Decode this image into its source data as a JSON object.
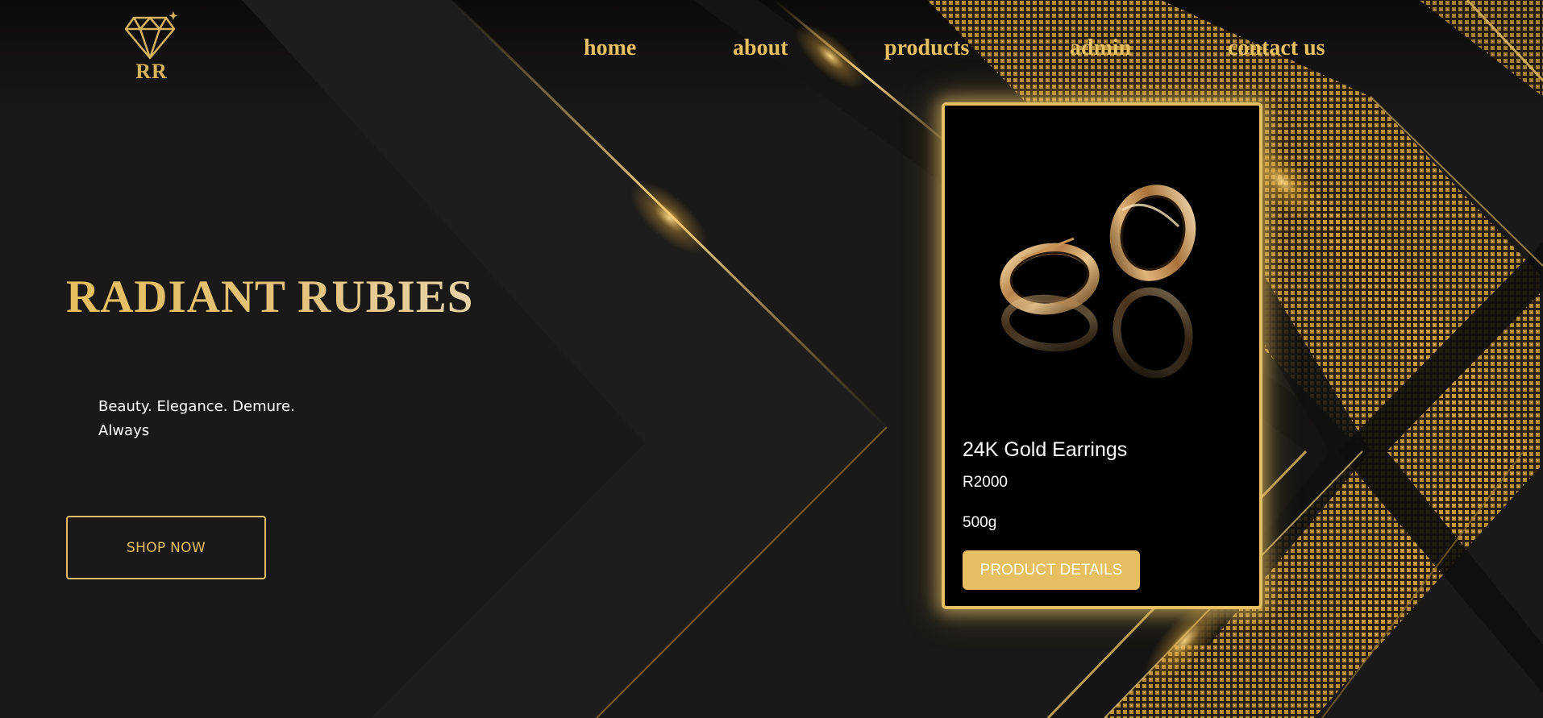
{
  "brand": {
    "logo_text": "RR"
  },
  "nav": {
    "items": [
      {
        "label": "home"
      },
      {
        "label": "about"
      },
      {
        "label": "products"
      },
      {
        "label": "admin"
      },
      {
        "label": "contact us"
      }
    ]
  },
  "hero": {
    "title": "RADIANT RUBIES",
    "tagline": "Beauty. Elegance. Demure. Always",
    "shop_button": "SHOP NOW"
  },
  "product_card": {
    "name": "24K Gold Earrings",
    "price": "R2000",
    "weight": "500g",
    "details_button": "PRODUCT DETAILS"
  },
  "colors": {
    "accent_gold": "#e6bf63",
    "background": "#1a1917",
    "card_background": "#000000"
  },
  "icons": {
    "logo": "diamond-icon",
    "sparkle": "sparkle-icon"
  }
}
